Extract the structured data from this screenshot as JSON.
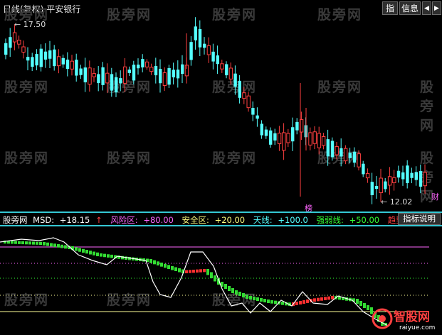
{
  "header": {
    "period": "日线(复权)",
    "stock_name": "平安银行",
    "buttons": [
      "指",
      "信息"
    ],
    "arrow_left": "◀",
    "arrow_right": "▶"
  },
  "price_chart": {
    "high_label": "17.50",
    "low_label": "12.02",
    "badge_bang": "榜",
    "badge_cai": "财"
  },
  "indicator": {
    "name": "股旁网",
    "msd_label": "MSD:",
    "msd_value": "+18.15",
    "risk_label": "风险区:",
    "risk_value": "+80.00",
    "safe_label": "安全区:",
    "safe_value": "+20.00",
    "sky_label": "天线:",
    "sky_value": "+100.0",
    "strong_label": "强弱线:",
    "strong_value": "+50.00",
    "trend_label": "趋势",
    "help_button": "指标说明"
  },
  "watermark": {
    "text": "股旁网"
  },
  "logo": {
    "text": "智股网",
    "url": "raiyue.com"
  },
  "colors": {
    "up": "#ff4040",
    "down": "#54ffff",
    "risk_line": "#ff66ff",
    "safe_line": "#ffff99",
    "msd_line": "#ffffff",
    "separator": "#35c8d4"
  }
}
